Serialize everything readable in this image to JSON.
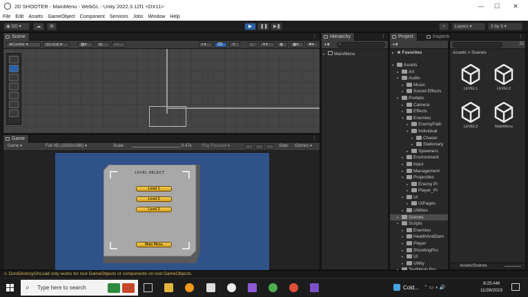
{
  "window": {
    "title": "2D SHOOTER - MainMenu - WebGL - Unity 2022.3.12f1 <DX11>",
    "controls": [
      "—",
      "☐",
      "✕"
    ]
  },
  "menu": [
    "File",
    "Edit",
    "Assets",
    "GameObject",
    "Component",
    "Services",
    "Jobs",
    "Window",
    "Help"
  ],
  "toolbar": {
    "account": "DD",
    "play_icon": "play-icon",
    "pause_icon": "pause-icon",
    "step_icon": "step-icon",
    "layers_label": "Layers",
    "layout_label": "2 by 3"
  },
  "scene": {
    "tab": "Scene",
    "pivot": "Center",
    "space": "Local",
    "mode_2d": "2D"
  },
  "game": {
    "tab": "Game",
    "display": "Game",
    "resolution": "Full HD (1920x1080)",
    "scale_label": "Scale",
    "scale_value": "0.47x",
    "play_focused": "Play Focused",
    "stats": "Stats",
    "gizmos": "Gizmos",
    "menu_title": "LEVEL SELECT",
    "buttons": [
      "Level 1",
      "Level 2",
      "Level 3"
    ],
    "back_button": "Main Menu"
  },
  "hierarchy": {
    "tab": "Hierarchy",
    "root": "MainMenu"
  },
  "project": {
    "tab": "Project",
    "inspector_tab": "Inspector",
    "count": "22",
    "favorites": "Favorites",
    "tree": [
      {
        "label": "Assets",
        "depth": 0,
        "open": true
      },
      {
        "label": "Art",
        "depth": 1,
        "open": false
      },
      {
        "label": "Audio",
        "depth": 1,
        "open": true
      },
      {
        "label": "Music",
        "depth": 2,
        "open": false
      },
      {
        "label": "Sound Effects",
        "depth": 2,
        "open": false
      },
      {
        "label": "Prefabs",
        "depth": 1,
        "open": true
      },
      {
        "label": "Camera",
        "depth": 2,
        "open": false
      },
      {
        "label": "Effects",
        "depth": 2,
        "open": false
      },
      {
        "label": "Enemies",
        "depth": 2,
        "open": true
      },
      {
        "label": "EnemyPath",
        "depth": 3,
        "open": false
      },
      {
        "label": "Individual",
        "depth": 3,
        "open": true
      },
      {
        "label": "Chaser",
        "depth": 4,
        "open": false
      },
      {
        "label": "Stationary",
        "depth": 4,
        "open": false
      },
      {
        "label": "Spawners",
        "depth": 3,
        "open": false
      },
      {
        "label": "Environment",
        "depth": 2,
        "open": false
      },
      {
        "label": "Input",
        "depth": 2,
        "open": false
      },
      {
        "label": "Management",
        "depth": 2,
        "open": false
      },
      {
        "label": "Projectiles",
        "depth": 2,
        "open": true
      },
      {
        "label": "Enemy Pr",
        "depth": 3,
        "open": false
      },
      {
        "label": "Player_Pr",
        "depth": 3,
        "open": false
      },
      {
        "label": "UI",
        "depth": 2,
        "open": true
      },
      {
        "label": "UIPages",
        "depth": 3,
        "open": false
      },
      {
        "label": "Utilities",
        "depth": 2,
        "open": false
      },
      {
        "label": "Scenes",
        "depth": 1,
        "open": false,
        "selected": true
      },
      {
        "label": "Scripts",
        "depth": 1,
        "open": true
      },
      {
        "label": "Enemies",
        "depth": 2,
        "open": false
      },
      {
        "label": "HealthAndDam",
        "depth": 2,
        "open": false
      },
      {
        "label": "Player",
        "depth": 2,
        "open": false
      },
      {
        "label": "ShootingPro",
        "depth": 2,
        "open": false
      },
      {
        "label": "UI",
        "depth": 2,
        "open": false
      },
      {
        "label": "Utility",
        "depth": 2,
        "open": false
      },
      {
        "label": "TextMesh Pro",
        "depth": 1,
        "open": false
      }
    ],
    "breadcrumb": [
      "Assets",
      "Scenes"
    ],
    "assets": [
      "LEVEL1",
      "LEVEL2",
      "LEVEL3",
      "MainMenu"
    ],
    "footer_path": "Assets/Scenes"
  },
  "status": {
    "message": "DontDestroyOnLoad only works for root GameObjects or components on root GameObjects."
  },
  "taskbar": {
    "search_placeholder": "Type here to search",
    "weather": "Cold...",
    "time": "8:25 AM",
    "date": "11/28/2023"
  }
}
